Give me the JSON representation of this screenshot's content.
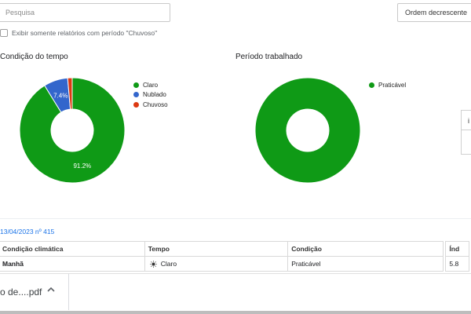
{
  "search": {
    "placeholder": "Pesquisa"
  },
  "sort": {
    "label": "Ordem decrescente"
  },
  "filter": {
    "label": "Exibir somente relatórios com período \"Chuvoso\""
  },
  "charts": {
    "weather": {
      "title": "Condição do tempo",
      "legend": [
        {
          "label": "Claro",
          "color": "#0f9a16"
        },
        {
          "label": "Nublado",
          "color": "#3366cc"
        },
        {
          "label": "Chuvoso",
          "color": "#dc3912"
        }
      ]
    },
    "period": {
      "title": "Período trabalhado",
      "legend": [
        {
          "label": "Praticável",
          "color": "#0f9a16"
        }
      ]
    }
  },
  "chart_data": [
    {
      "type": "pie",
      "title": "Condição do tempo",
      "categories": [
        "Claro",
        "Nublado",
        "Chuvoso"
      ],
      "values": [
        91.2,
        7.4,
        1.4
      ],
      "value_labels": [
        "91.2%",
        "7.4%",
        ""
      ],
      "colors": [
        "#0f9a16",
        "#3366cc",
        "#dc3912"
      ],
      "legend": "right"
    },
    {
      "type": "pie",
      "title": "Período trabalhado",
      "categories": [
        "Praticável"
      ],
      "values": [
        100
      ],
      "colors": [
        "#0f9a16"
      ],
      "legend": "right"
    }
  ],
  "right_panel": {
    "header": "i"
  },
  "report": {
    "link": "13/04/2023 nº 415",
    "table": {
      "headers": [
        "Condição climática",
        "Tempo",
        "Condição",
        "Índ"
      ],
      "rows": [
        {
          "period": "Manhã",
          "weather": "Claro",
          "condition": "Praticável",
          "index": "5.8"
        }
      ]
    }
  },
  "download": {
    "filename": "o de....pdf"
  }
}
